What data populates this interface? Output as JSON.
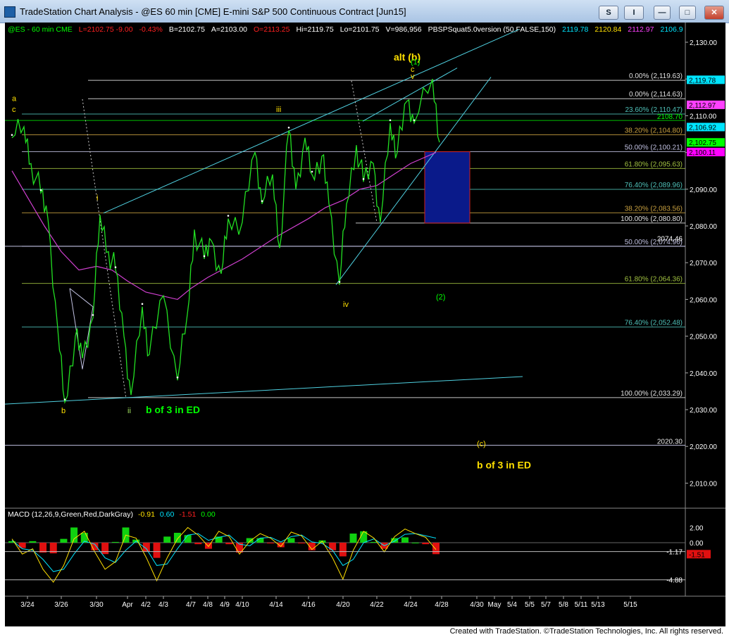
{
  "window": {
    "title": "TradeStation Chart Analysis - @ES 60 min [CME] E-mini S&P 500 Continuous Contract [Jun15]",
    "buttons": [
      "S",
      "I",
      "—",
      "□",
      "✕"
    ]
  },
  "status_line": [
    {
      "text": "@ES - 60 min  CME",
      "color": "#00ff00"
    },
    {
      "text": "L=2102.75  -9.00",
      "color": "#ff2020"
    },
    {
      "text": "-0.43%",
      "color": "#ff2020"
    },
    {
      "text": "B=2102.75",
      "color": "#ffffff"
    },
    {
      "text": "A=2103.00",
      "color": "#ffffff"
    },
    {
      "text": "O=2113.25",
      "color": "#ff2020"
    },
    {
      "text": "Hi=2119.75",
      "color": "#ffffff"
    },
    {
      "text": "Lo=2101.75",
      "color": "#ffffff"
    },
    {
      "text": "V=986,956",
      "color": "#ffffff"
    },
    {
      "text": "PBSPSquat5.0version (50,FALSE,150)",
      "color": "#ffffff"
    },
    {
      "text": "2119.78",
      "color": "#00e5ff"
    },
    {
      "text": "2120.84",
      "color": "#ffe000"
    },
    {
      "text": "2112.97",
      "color": "#ff40ff"
    },
    {
      "text": "2106.9",
      "color": "#00e5ff"
    }
  ],
  "macd_header": [
    {
      "text": "MACD (12,26,9,Green,Red,DarkGray)",
      "color": "#ffffff"
    },
    {
      "text": "-0.91",
      "color": "#ffe000"
    },
    {
      "text": "0.60",
      "color": "#00e5ff"
    },
    {
      "text": "-1.51",
      "color": "#ff2020"
    },
    {
      "text": "0.00",
      "color": "#00ff00"
    }
  ],
  "credit": "Created with TradeStation. ©TradeStation Technologies, Inc. All rights reserved.",
  "chart_data": {
    "type": "line",
    "title": "@ES 60 min [CME] E-mini S&P 500 Continuous Contract [Jun15]",
    "ylim": [
      2000,
      2135
    ],
    "price_ticks": [
      "2,130.00",
      "2,120.00",
      "2,110.00",
      "2,100.00",
      "2,090.00",
      "2,080.00",
      "2,070.00",
      "2,060.00",
      "2,050.00",
      "2,040.00",
      "2,030.00",
      "2,020.00",
      "2,010.00"
    ],
    "x_ticks": [
      "3/24",
      "3/26",
      "3/30",
      "Apr",
      "4/2",
      "4/3",
      "4/7",
      "4/8",
      "4/9",
      "4/10",
      "4/14",
      "4/16",
      "4/20",
      "4/22",
      "4/24",
      "4/28",
      "4/30",
      "May",
      "5/4",
      "5/5",
      "5/7",
      "5/8",
      "5/11",
      "5/13",
      "5/15"
    ],
    "price_series": {
      "name": "@ES",
      "x": [
        "3/23",
        "3/24",
        "3/24",
        "3/25",
        "3/25",
        "3/26",
        "3/26",
        "3/27",
        "3/27",
        "3/30",
        "3/30",
        "3/31",
        "3/31",
        "4/1",
        "4/1",
        "4/2",
        "4/2",
        "4/3",
        "4/6",
        "4/7",
        "4/7",
        "4/8",
        "4/8",
        "4/9",
        "4/9",
        "4/10",
        "4/13",
        "4/13",
        "4/14",
        "4/14",
        "4/15",
        "4/15",
        "4/16",
        "4/16",
        "4/17",
        "4/17",
        "4/20",
        "4/20",
        "4/21",
        "4/21",
        "4/22",
        "4/22",
        "4/23",
        "4/23",
        "4/24",
        "4/24",
        "4/27",
        "4/27"
      ],
      "y": [
        2104,
        2107,
        2097,
        2089,
        2082,
        2052,
        2032,
        2050,
        2044,
        2055,
        2083,
        2073,
        2068,
        2050,
        2034,
        2058,
        2045,
        2061,
        2038,
        2056,
        2079,
        2071,
        2076,
        2067,
        2082,
        2081,
        2100,
        2086,
        2094,
        2074,
        2106,
        2090,
        2104,
        2094,
        2099,
        2086,
        2064,
        2086,
        2102,
        2092,
        2097,
        2081,
        2108,
        2100,
        2114,
        2108,
        2120,
        2102.75
      ]
    },
    "moving_average": {
      "x": [
        "3/23",
        "3/25",
        "3/26",
        "3/27",
        "3/30",
        "3/31",
        "4/1",
        "4/2",
        "4/6",
        "4/7",
        "4/8",
        "4/10",
        "4/14",
        "4/16",
        "4/17",
        "4/20",
        "4/21",
        "4/22",
        "4/23",
        "4/24",
        "4/27"
      ],
      "y": [
        2095,
        2080,
        2073,
        2068,
        2069,
        2068,
        2065,
        2062,
        2060,
        2063,
        2066,
        2071,
        2077,
        2082,
        2085,
        2087,
        2090,
        2091,
        2094,
        2097,
        2100
      ]
    },
    "fib_levels": [
      {
        "label": "0.00% (2,119.63)",
        "value": 2119.63,
        "color": "#e8e8e8"
      },
      {
        "label": "0.00% (2,114.63)",
        "value": 2114.63,
        "color": "#e8e8e8"
      },
      {
        "label": "23.60% (2,110.47)",
        "value": 2110.47,
        "color": "#4fc0b8"
      },
      {
        "label": "38.20% (2,104.80)",
        "value": 2104.8,
        "color": "#c8a040"
      },
      {
        "label": "50.00% (2,100.21)",
        "value": 2100.21,
        "color": "#c0c0e0"
      },
      {
        "label": "61.80% (2,095.63)",
        "value": 2095.63,
        "color": "#a0c040"
      },
      {
        "label": "76.40% (2,089.96)",
        "value": 2089.96,
        "color": "#4fc0b8"
      },
      {
        "label": "38.20% (2,083.56)",
        "value": 2083.56,
        "color": "#c8a040"
      },
      {
        "label": "100.00% (2,080.80)",
        "value": 2080.8,
        "color": "#e8e8e8"
      },
      {
        "label": "50.00% (2,074.96)",
        "value": 2074.46,
        "color": "#c0c0e0"
      },
      {
        "label": "61.80% (2,064.36)",
        "value": 2064.36,
        "color": "#a0c040"
      },
      {
        "label": "76.40% (2,052.48)",
        "value": 2052.48,
        "color": "#4fc0b8"
      },
      {
        "label": "100.00% (2,033.29)",
        "value": 2033.29,
        "color": "#e8e8e8"
      }
    ],
    "level_notes": [
      {
        "label": "2108.70",
        "value": 2108.7,
        "color": "#00ff00"
      },
      {
        "label": "2074.46",
        "value": 2075.5,
        "color": "#ffffff"
      },
      {
        "label": "2020.30",
        "value": 2020.3,
        "color": "#e8e8e8"
      }
    ],
    "price_flags": [
      {
        "text": "2,119.78",
        "value": 2119.78,
        "bg": "#00e5ff",
        "fg": "#000000"
      },
      {
        "text": "2,112.97",
        "value": 2112.97,
        "bg": "#ff40ff",
        "fg": "#000000"
      },
      {
        "text": "2,106.92",
        "value": 2106.92,
        "bg": "#00e5ff",
        "fg": "#000000"
      },
      {
        "text": "2,102.75",
        "value": 2102.75,
        "bg": "#00ff00",
        "fg": "#000000"
      },
      {
        "text": "2,100.11",
        "value": 2100.11,
        "bg": "#ff00ff",
        "fg": "#000000"
      }
    ],
    "wave_labels": [
      {
        "text": "a",
        "x": "3/23",
        "y": 2114,
        "color": "#ffe000"
      },
      {
        "text": "c",
        "x": "3/23",
        "y": 2111,
        "color": "#ffe000"
      },
      {
        "text": "b",
        "x": "3/26",
        "y": 2029,
        "color": "#ffe000"
      },
      {
        "text": "i",
        "x": "3/30",
        "y": 2087,
        "color": "#ffe000"
      },
      {
        "text": "ii",
        "x": "4/1",
        "y": 2029,
        "color": "#a0e060"
      },
      {
        "text": "b of 3 in ED",
        "x": "4/2",
        "y": 2029,
        "color": "#00ff00"
      },
      {
        "text": "iii",
        "x": "4/14",
        "y": 2111,
        "color": "#ffe000"
      },
      {
        "text": "iv",
        "x": "4/20",
        "y": 2058,
        "color": "#ffe000"
      },
      {
        "text": "alt (b)",
        "x": "4/23",
        "y": 2125,
        "color": "#ffe000"
      },
      {
        "text": "(1)",
        "x": "4/24",
        "y": 2124,
        "color": "#00ff00"
      },
      {
        "text": "c",
        "x": "4/24",
        "y": 2122,
        "color": "#ffe000"
      },
      {
        "text": "v",
        "x": "4/24",
        "y": 2120,
        "color": "#ffe000"
      },
      {
        "text": "(2)",
        "x": "4/27",
        "y": 2060,
        "color": "#00ff00"
      },
      {
        "text": "(c)",
        "x": "4/30",
        "y": 2020,
        "color": "#ffe000"
      },
      {
        "text": "b of 3 in ED",
        "x": "4/30",
        "y": 2014,
        "color": "#ffe000"
      }
    ],
    "macd": {
      "label": "MACD (12,26,9,Green,Red,DarkGray)",
      "ylim": [
        -6,
        3
      ],
      "ticks": [
        "2.00",
        "0.00",
        "-1.17",
        "-1.51",
        "-4.88"
      ],
      "macd_line": [
        0.5,
        -1.5,
        -0.8,
        -3.5,
        -5.2,
        -3,
        0.5,
        1.5,
        -1.2,
        -3.5,
        -2.5,
        1,
        0.6,
        -2,
        -5,
        -2,
        0.5,
        2,
        1,
        -0.5,
        1.5,
        0.8,
        -1.5,
        0.2,
        1.2,
        0.6,
        -0.5,
        1.4,
        0.9,
        -0.9,
        0.2,
        -2,
        -4.8,
        -1,
        1.5,
        0.6,
        -1.2,
        0.8,
        1.8,
        1.2,
        0.7,
        -0.91
      ],
      "signal_line": [
        0.3,
        -0.8,
        -1,
        -2.2,
        -3.8,
        -3.5,
        -1.5,
        0.2,
        -0.2,
        -2,
        -2.6,
        -1,
        0.2,
        -0.8,
        -3,
        -2.8,
        -0.8,
        1,
        1.2,
        0.3,
        0.7,
        1,
        -0.2,
        -0.4,
        0.6,
        0.7,
        0.1,
        0.8,
        1,
        0.1,
        -0.1,
        -1,
        -3,
        -2.2,
        0,
        0.5,
        -0.4,
        0.2,
        1.1,
        1.2,
        0.9,
        0.6
      ],
      "histogram": [
        0.2,
        -0.7,
        0.2,
        -1.3,
        -1.4,
        0.5,
        2,
        1.3,
        -1,
        -1.5,
        0.1,
        2,
        0.4,
        -1.2,
        -2,
        0.8,
        1.3,
        1,
        -0.2,
        -0.8,
        0.8,
        -0.2,
        -1.3,
        0.6,
        0.6,
        -0.1,
        -0.6,
        0.6,
        -0.1,
        -1,
        0.3,
        -1,
        -1.8,
        1.2,
        1.5,
        0.1,
        -0.8,
        0.6,
        0.7,
        0,
        -0.2,
        -1.51
      ]
    }
  }
}
